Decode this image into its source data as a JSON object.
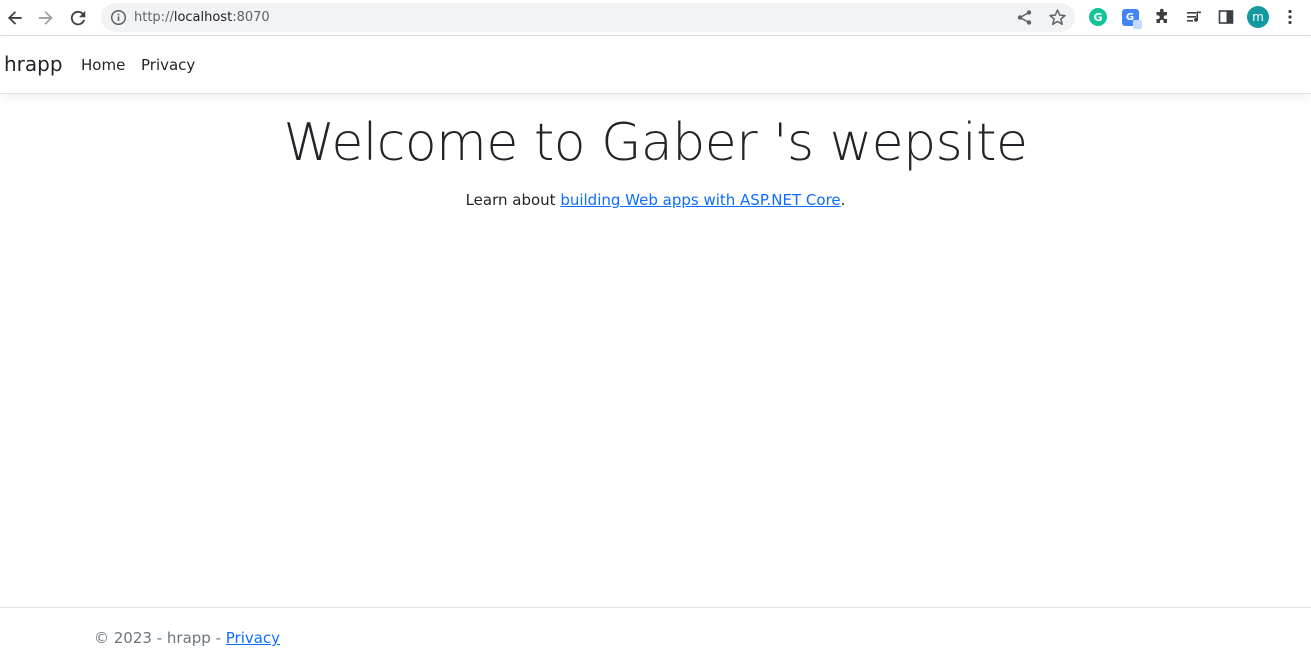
{
  "browser": {
    "url_scheme": "http://",
    "url_host": "localhost",
    "url_port": ":8070",
    "avatar_letter": "m",
    "grammarly_letter": "G",
    "translate_letter": "G",
    "icons": [
      "back-icon",
      "forward-icon",
      "reload-icon",
      "info-icon",
      "share-icon",
      "star-icon",
      "grammarly-icon",
      "translate-icon",
      "extensions-icon",
      "reading-list-icon",
      "side-panel-icon",
      "menu-icon"
    ]
  },
  "navbar": {
    "brand": "hrapp",
    "links": [
      {
        "label": "Home"
      },
      {
        "label": "Privacy"
      }
    ]
  },
  "main": {
    "heading": "Welcome to Gaber 's wepsite",
    "lead_prefix": "Learn about ",
    "lead_link": "building Web apps with ASP.NET Core",
    "lead_suffix": "."
  },
  "footer": {
    "copyright": "© 2023 - hrapp - ",
    "privacy_link": "Privacy"
  },
  "colors": {
    "link": "#0d6efd",
    "text": "#212529",
    "muted": "#6c757d",
    "avatar": "#129aa3",
    "grammarly": "#15c39a",
    "translate": "#4285f4"
  }
}
